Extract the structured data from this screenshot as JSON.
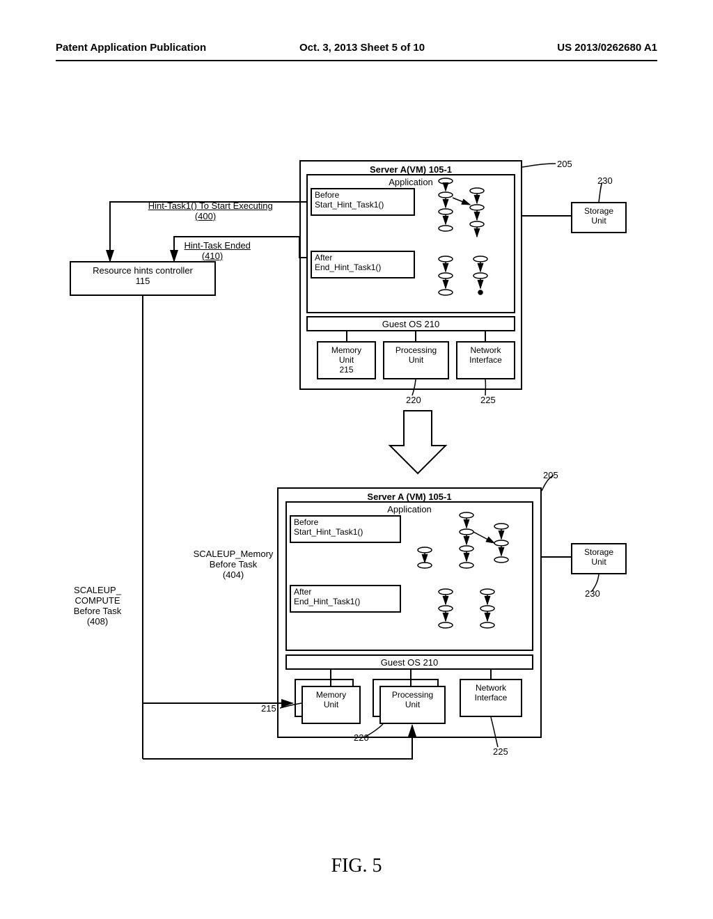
{
  "header": {
    "left": "Patent Application Publication",
    "mid": "Oct. 3, 2013   Sheet 5 of 10",
    "right": "US 2013/0262680 A1"
  },
  "figure_caption": "FIG. 5",
  "labels": {
    "hint_start": "Hint-Task1() To Start Executing\n(400)",
    "hint_end": "Hint-Task Ended\n(410)",
    "controller": "Resource hints controller\n115",
    "scaleup_mem": "SCALEUP_Memory\nBefore Task\n(404)",
    "scaleup_cpu": "SCALEUP_\nCOMPUTE\nBefore Task\n(408)",
    "server_title": "Server A(VM) 105-1",
    "server_title2": "Server A (VM) 105-1",
    "application": "Application",
    "before_hint": "Before\nStart_Hint_Task1()",
    "after_hint": "After\nEnd_Hint_Task1()",
    "guest_os": "Guest OS  210",
    "memory_unit": "Memory\nUnit\n215",
    "memory_unit_short": "Memory\nUnit",
    "processing_unit": "Processing\nUnit",
    "network_if": "Network\nInterface",
    "storage_unit": "Storage\nUnit",
    "ref_205": "205",
    "ref_230": "230",
    "ref_215": "215",
    "ref_220": "220",
    "ref_225": "225"
  }
}
